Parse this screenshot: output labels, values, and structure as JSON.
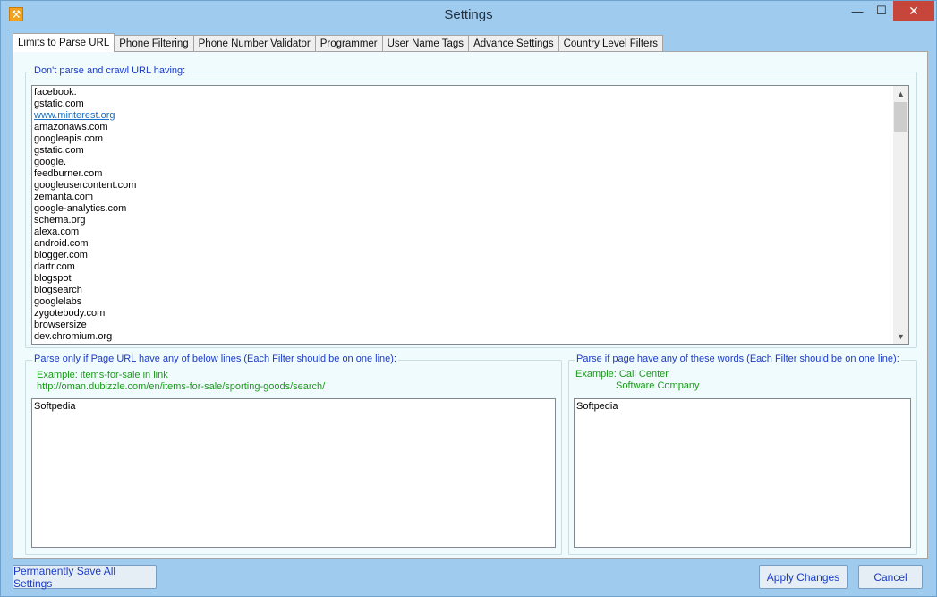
{
  "window": {
    "title": "Settings",
    "app_icon": "wrench-icon",
    "minimize_glyph": "—",
    "maximize_glyph": "☐",
    "close_glyph": "✕"
  },
  "tabs": [
    {
      "label": "Limits to Parse URL",
      "active": true
    },
    {
      "label": "Phone Filtering",
      "active": false
    },
    {
      "label": "Phone Number Validator",
      "active": false
    },
    {
      "label": "Programmer",
      "active": false
    },
    {
      "label": "User Name Tags",
      "active": false
    },
    {
      "label": "Advance Settings",
      "active": false
    },
    {
      "label": "Country Level Filters",
      "active": false
    }
  ],
  "url_exclusions": {
    "label": "Don't parse and crawl URL having:",
    "items": [
      "facebook.",
      "gstatic.com",
      "www.minterest.org",
      "amazonaws.com",
      "googleapis.com",
      "gstatic.com",
      "google.",
      "feedburner.com",
      "googleusercontent.com",
      "zemanta.com",
      "google-analytics.com",
      "schema.org",
      "alexa.com",
      "android.com",
      "blogger.com",
      "dartr.com",
      "blogspot",
      "blogsearch",
      "googlelabs",
      "zygotebody.com",
      "browsersize",
      "dev.chromium.org"
    ],
    "link_item": "www.minterest.org"
  },
  "url_filter": {
    "label": "Parse only if Page URL have any of below lines (Each Filter should be on one line):",
    "hint_line1": "Example: items-for-sale in link",
    "hint_line2": "http://oman.dubizzle.com/en/items-for-sale/sporting-goods/search/",
    "value": "Softpedia"
  },
  "word_filter": {
    "label": "Parse if page have any of these words (Each Filter should be on one line):",
    "hint_line1": "Example: Call Center",
    "hint_line2": "Software Company",
    "value": "Softpedia"
  },
  "buttons": {
    "save_all": "Permanently Save All Settings",
    "apply": "Apply Changes",
    "cancel": "Cancel"
  }
}
